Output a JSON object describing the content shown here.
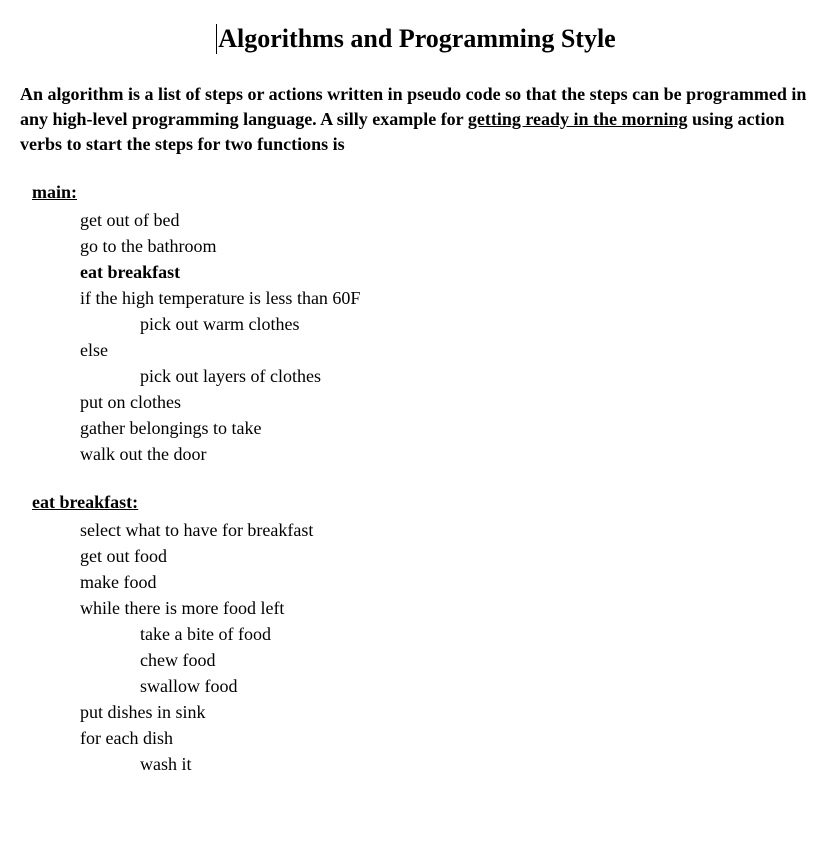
{
  "title": "Algorithms and Programming Style",
  "intro": {
    "p1a": "An algorithm is a list of steps or actions written in pseudo code so that the steps can be programmed in any high-level  programming language. A silly example for ",
    "p1b": "getting ready in the morning",
    "p1c": " using action verbs to start the steps for two functions is"
  },
  "main_heading": "main:",
  "main_steps": [
    {
      "text": "get out of bed",
      "indent": 0,
      "bold": false
    },
    {
      "text": "go to the bathroom",
      "indent": 0,
      "bold": false
    },
    {
      "text": "eat breakfast",
      "indent": 0,
      "bold": true
    },
    {
      "text": "if the high temperature is less than 60F",
      "indent": 0,
      "bold": false
    },
    {
      "text": "pick out warm clothes",
      "indent": 1,
      "bold": false
    },
    {
      "text": "else",
      "indent": 0,
      "bold": false
    },
    {
      "text": "pick out layers of clothes",
      "indent": 1,
      "bold": false
    },
    {
      "text": "put on clothes",
      "indent": 0,
      "bold": false
    },
    {
      "text": "gather belongings to take",
      "indent": 0,
      "bold": false
    },
    {
      "text": "walk out the door",
      "indent": 0,
      "bold": false
    }
  ],
  "eat_heading": "eat breakfast:",
  "eat_steps": [
    {
      "text": "select what to have for breakfast",
      "indent": 0,
      "bold": false
    },
    {
      "text": "get out food",
      "indent": 0,
      "bold": false
    },
    {
      "text": "make food",
      "indent": 0,
      "bold": false
    },
    {
      "text": "while there is more food left",
      "indent": 0,
      "bold": false
    },
    {
      "text": "take a bite of food",
      "indent": 1,
      "bold": false
    },
    {
      "text": "chew food",
      "indent": 1,
      "bold": false
    },
    {
      "text": "swallow food",
      "indent": 1,
      "bold": false
    },
    {
      "text": "put dishes in sink",
      "indent": 0,
      "bold": false
    },
    {
      "text": "for each dish",
      "indent": 0,
      "bold": false
    },
    {
      "text": "wash it",
      "indent": 1,
      "bold": false
    }
  ]
}
